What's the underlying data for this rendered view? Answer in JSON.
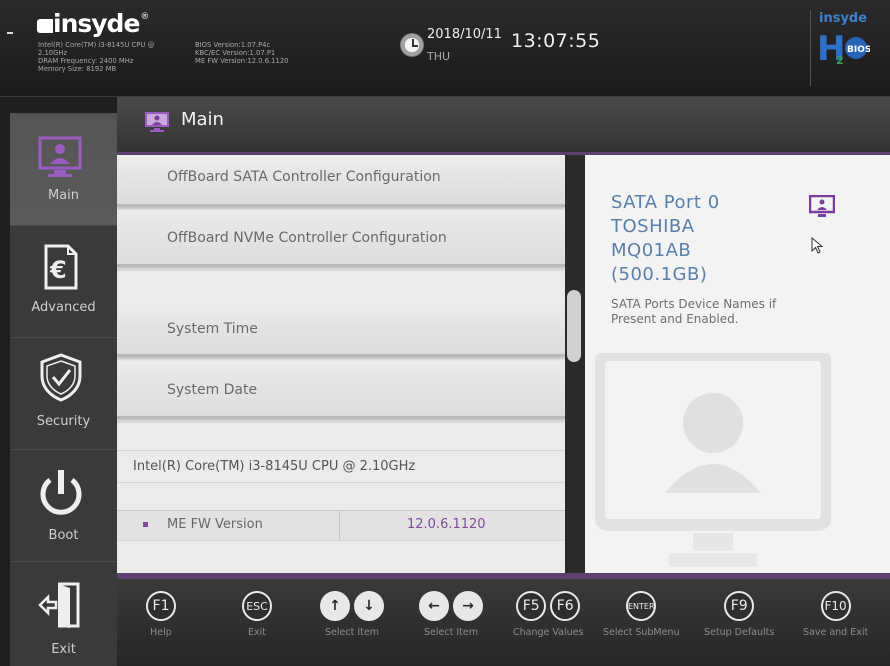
{
  "header": {
    "brand": "insyde",
    "brand_mark": "®",
    "sysinfo": [
      "Intel(R) Core(TM) i3-8145U CPU @",
      "2.10GHz",
      "DRAM Frequency: 2400 MHz",
      "Memory Size: 8192 MB"
    ],
    "biosinfo": [
      "BIOS Version:1.07.P4c",
      "KBC/EC Version:1.07.P1",
      "ME FW Version:12.0.6.1120"
    ],
    "date": "2018/10/11",
    "day": "THU",
    "time": "13:07:55",
    "h2o_logo": {
      "top_text": "insyde",
      "letter": "H",
      "sub": "2",
      "badge": "BIOS"
    }
  },
  "sidebar": {
    "items": [
      {
        "label": "Main",
        "icon": "monitor-icon",
        "active": true
      },
      {
        "label": "Advanced",
        "icon": "advanced-document-icon",
        "active": false
      },
      {
        "label": "Security",
        "icon": "shield-icon",
        "active": false
      },
      {
        "label": "Boot",
        "icon": "power-icon",
        "active": false
      },
      {
        "label": "Exit",
        "icon": "exit-door-icon",
        "active": false
      }
    ]
  },
  "page": {
    "title": "Main"
  },
  "list": {
    "offboard_sata": "OffBoard SATA Controller Configuration",
    "offboard_nvme": "OffBoard NVMe Controller Configuration",
    "system_time": "System Time",
    "system_date": "System Date",
    "cpu": "Intel(R) Core(TM) i3-8145U CPU @ 2.10GHz",
    "me_fw_label": "ME FW Version",
    "me_fw_value": "12.0.6.1120"
  },
  "help": {
    "title": "SATA Port 0\nTOSHIBA\nMQ01AB\n(500.1GB)",
    "description": "SATA Ports Device Names if Present and Enabled."
  },
  "footer": {
    "keys": [
      {
        "keys": [
          "F1"
        ],
        "label": "Help"
      },
      {
        "keys": [
          "ESC"
        ],
        "label": "Exit"
      },
      {
        "keys": [
          "↑",
          "↓"
        ],
        "label": "Select Item"
      },
      {
        "keys": [
          "←",
          "→"
        ],
        "label": "Select Item"
      },
      {
        "keys": [
          "F5",
          "F6"
        ],
        "label": "Change Values"
      },
      {
        "keys": [
          "ENTER"
        ],
        "label": "Select SubMenu"
      },
      {
        "keys": [
          "F9"
        ],
        "label": "Setup Defaults"
      },
      {
        "keys": [
          "F10"
        ],
        "label": "Save and Exit"
      }
    ]
  },
  "colors": {
    "accent": "#5d3f70",
    "value": "#7d4e96",
    "help_title": "#5a7fa8"
  }
}
